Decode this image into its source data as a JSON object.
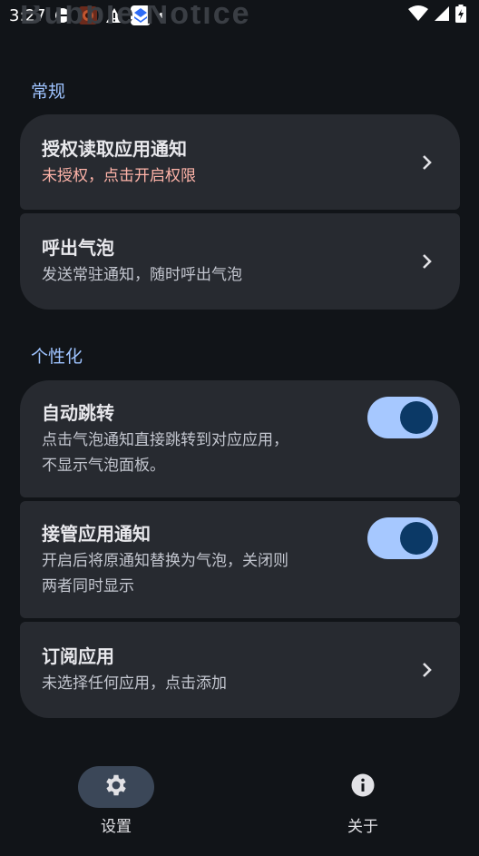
{
  "status_bar": {
    "time": "3:27",
    "icons": [
      "dnd-icon",
      "app-notification-icon",
      "warning-icon",
      "app-icon",
      "dot-icon"
    ],
    "right_icons": [
      "wifi-icon",
      "signal-icon",
      "battery-charging-icon"
    ]
  },
  "app_title_partial": "Bubble Notice",
  "sections": {
    "general": {
      "header": "常规",
      "items": [
        {
          "title": "授权读取应用通知",
          "subtitle": "未授权，点击开启权限"
        },
        {
          "title": "呼出气泡",
          "subtitle": "发送常驻通知，随时呼出气泡"
        }
      ]
    },
    "personalize": {
      "header": "个性化",
      "items": [
        {
          "title": "自动跳转",
          "subtitle_line1": "点击气泡通知直接跳转到对应应用，",
          "subtitle_line2": "不显示气泡面板。",
          "switch_on": true
        },
        {
          "title": "接管应用通知",
          "subtitle_line1": "开启后将原通知替换为气泡，关闭则",
          "subtitle_line2": "两者同时显示",
          "switch_on": true
        },
        {
          "title": "订阅应用",
          "subtitle": "未选择任何应用，点击添加"
        }
      ]
    }
  },
  "nav": {
    "settings_label": "设置",
    "about_label": "关于"
  },
  "colors": {
    "background": "#111418",
    "card": "#272a30",
    "accent": "#9ec3ff",
    "warning_text": "#ffb4a9",
    "switch_track": "#a6c8ff",
    "switch_thumb": "#0b3966"
  }
}
